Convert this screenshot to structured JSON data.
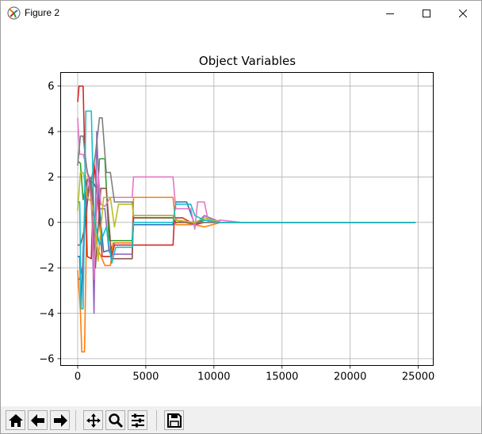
{
  "window": {
    "title": "Figure 2",
    "icons": {
      "app": "matplotlib-icon",
      "minimize": "minimize-icon",
      "maximize": "maximize-icon",
      "close": "close-icon"
    }
  },
  "toolbar": {
    "buttons": [
      {
        "name": "home-icon",
        "tooltip": "Home"
      },
      {
        "name": "back-icon",
        "tooltip": "Back"
      },
      {
        "name": "forward-icon",
        "tooltip": "Forward"
      },
      {
        "name": "pan-icon",
        "tooltip": "Pan"
      },
      {
        "name": "zoom-icon",
        "tooltip": "Zoom"
      },
      {
        "name": "configure-subplots-icon",
        "tooltip": "Subplots"
      },
      {
        "name": "save-icon",
        "tooltip": "Save"
      }
    ]
  },
  "chart_data": {
    "type": "line",
    "title": "Object Variables",
    "xlabel": "",
    "ylabel": "",
    "xlim": [
      -1250,
      26100
    ],
    "ylim": [
      -6.3,
      6.6
    ],
    "xticks": [
      0,
      5000,
      10000,
      15000,
      20000,
      25000
    ],
    "xtick_labels": [
      "0",
      "5000",
      "10000",
      "15000",
      "20000",
      "25000"
    ],
    "yticks": [
      -6,
      -4,
      -2,
      0,
      2,
      4,
      6
    ],
    "ytick_labels": [
      "−6",
      "−4",
      "−2",
      "0",
      "2",
      "4",
      "6"
    ],
    "grid": true,
    "legend": "none",
    "series": [
      {
        "color": "#1f77b4",
        "points": [
          [
            0,
            -1.5
          ],
          [
            150,
            -1.5
          ],
          [
            250,
            -3.8
          ],
          [
            500,
            0.3
          ],
          [
            900,
            1.9
          ],
          [
            1200,
            1.7
          ],
          [
            1500,
            1.3
          ],
          [
            1900,
            -1.3
          ],
          [
            2400,
            -1.2
          ],
          [
            2700,
            -0.9
          ],
          [
            4000,
            -0.9
          ],
          [
            4100,
            -0.1
          ],
          [
            7000,
            -0.1
          ],
          [
            7200,
            0.9
          ],
          [
            8000,
            0.9
          ],
          [
            8600,
            -0.1
          ],
          [
            9300,
            0.2
          ],
          [
            10500,
            0.0
          ],
          [
            12000,
            0.0
          ],
          [
            24800,
            0.0
          ]
        ]
      },
      {
        "color": "#ff7f0e",
        "points": [
          [
            0,
            -2.1
          ],
          [
            200,
            -3.9
          ],
          [
            300,
            -5.7
          ],
          [
            500,
            -5.7
          ],
          [
            700,
            1.5
          ],
          [
            900,
            1.4
          ],
          [
            1200,
            -0.5
          ],
          [
            1500,
            -1.2
          ],
          [
            2000,
            -1.9
          ],
          [
            2400,
            -1.9
          ],
          [
            2600,
            -0.9
          ],
          [
            4000,
            -0.9
          ],
          [
            4100,
            1.1
          ],
          [
            7000,
            1.1
          ],
          [
            7200,
            -0.1
          ],
          [
            8600,
            -0.1
          ],
          [
            9300,
            -0.2
          ],
          [
            10500,
            0.0
          ],
          [
            12000,
            0.0
          ],
          [
            24800,
            0.0
          ]
        ]
      },
      {
        "color": "#2ca02c",
        "points": [
          [
            0,
            2.7
          ],
          [
            200,
            2.6
          ],
          [
            400,
            1.0
          ],
          [
            700,
            1.9
          ],
          [
            1000,
            1.9
          ],
          [
            1300,
            -0.5
          ],
          [
            1600,
            2.8
          ],
          [
            2000,
            2.8
          ],
          [
            2300,
            -0.8
          ],
          [
            4000,
            -0.8
          ],
          [
            4100,
            0.2
          ],
          [
            7000,
            0.2
          ],
          [
            7300,
            0.1
          ],
          [
            8600,
            -0.1
          ],
          [
            9300,
            0.1
          ],
          [
            10500,
            0.0
          ],
          [
            12000,
            0.0
          ],
          [
            24800,
            0.0
          ]
        ]
      },
      {
        "color": "#d62728",
        "points": [
          [
            0,
            5.3
          ],
          [
            100,
            6.0
          ],
          [
            400,
            6.0
          ],
          [
            700,
            -1.5
          ],
          [
            1000,
            -1.6
          ],
          [
            1200,
            2.6
          ],
          [
            1500,
            0.9
          ],
          [
            1800,
            -1.5
          ],
          [
            2300,
            -1.5
          ],
          [
            2500,
            -1.5
          ],
          [
            2700,
            -1.0
          ],
          [
            3500,
            -1.0
          ],
          [
            4000,
            -1.0
          ],
          [
            4100,
            -1.0
          ],
          [
            7000,
            -1.0
          ],
          [
            7100,
            0.2
          ],
          [
            7700,
            0.2
          ],
          [
            8600,
            -0.1
          ],
          [
            9300,
            0.0
          ],
          [
            10500,
            0.0
          ],
          [
            12000,
            0.0
          ],
          [
            24800,
            0.0
          ]
        ]
      },
      {
        "color": "#9467bd",
        "points": [
          [
            0,
            -2.5
          ],
          [
            150,
            -2.5
          ],
          [
            400,
            -1.8
          ],
          [
            700,
            1.8
          ],
          [
            1000,
            2.0
          ],
          [
            1200,
            -4.0
          ],
          [
            1400,
            4.0
          ],
          [
            1600,
            0.6
          ],
          [
            2000,
            0.6
          ],
          [
            2300,
            -1.3
          ],
          [
            2600,
            -1.4
          ],
          [
            4000,
            -1.4
          ],
          [
            4100,
            0.3
          ],
          [
            7000,
            0.3
          ],
          [
            7200,
            0.1
          ],
          [
            8600,
            -0.1
          ],
          [
            9300,
            0.3
          ],
          [
            10500,
            0.0
          ],
          [
            12000,
            0.0
          ],
          [
            24800,
            0.0
          ]
        ]
      },
      {
        "color": "#8c564b",
        "points": [
          [
            0,
            -1.0
          ],
          [
            200,
            -1.0
          ],
          [
            500,
            -0.3
          ],
          [
            900,
            1.9
          ],
          [
            1300,
            -2.0
          ],
          [
            1700,
            1.5
          ],
          [
            2100,
            1.5
          ],
          [
            2500,
            -1.6
          ],
          [
            4000,
            -1.6
          ],
          [
            4100,
            0.2
          ],
          [
            7000,
            0.2
          ],
          [
            7200,
            0.0
          ],
          [
            8600,
            0.0
          ],
          [
            9300,
            0.0
          ],
          [
            12000,
            0.0
          ],
          [
            24800,
            0.0
          ]
        ]
      },
      {
        "color": "#e377c2",
        "points": [
          [
            0,
            4.6
          ],
          [
            150,
            3.0
          ],
          [
            400,
            3.0
          ],
          [
            700,
            2.3
          ],
          [
            1000,
            1.0
          ],
          [
            1200,
            -2.5
          ],
          [
            1500,
            2.2
          ],
          [
            1700,
            0.8
          ],
          [
            2000,
            0.7
          ],
          [
            2400,
            1.1
          ],
          [
            3000,
            1.1
          ],
          [
            4000,
            1.1
          ],
          [
            4100,
            2.0
          ],
          [
            7000,
            2.0
          ],
          [
            7200,
            0.6
          ],
          [
            8300,
            0.6
          ],
          [
            8600,
            -0.3
          ],
          [
            8800,
            0.9
          ],
          [
            9300,
            0.9
          ],
          [
            9600,
            0.0
          ],
          [
            10500,
            0.1
          ],
          [
            12000,
            0.0
          ],
          [
            24800,
            0.0
          ]
        ]
      },
      {
        "color": "#7f7f7f",
        "points": [
          [
            0,
            2.5
          ],
          [
            200,
            3.8
          ],
          [
            400,
            3.8
          ],
          [
            700,
            2.2
          ],
          [
            1000,
            1.8
          ],
          [
            1300,
            3.0
          ],
          [
            1600,
            4.6
          ],
          [
            1800,
            4.6
          ],
          [
            2100,
            2.2
          ],
          [
            2400,
            2.2
          ],
          [
            2700,
            0.9
          ],
          [
            4000,
            0.9
          ],
          [
            4100,
            0.3
          ],
          [
            7000,
            0.3
          ],
          [
            7100,
            0.1
          ],
          [
            8600,
            0.0
          ],
          [
            9300,
            0.0
          ],
          [
            12000,
            0.0
          ],
          [
            24800,
            0.0
          ]
        ]
      },
      {
        "color": "#bcbd22",
        "points": [
          [
            0,
            0.5
          ],
          [
            200,
            2.2
          ],
          [
            400,
            2.2
          ],
          [
            700,
            1.1
          ],
          [
            1000,
            0.9
          ],
          [
            1300,
            0.1
          ],
          [
            1500,
            -1.7
          ],
          [
            1900,
            1.1
          ],
          [
            2400,
            1.1
          ],
          [
            2700,
            -0.2
          ],
          [
            3000,
            0.8
          ],
          [
            4000,
            0.8
          ],
          [
            4100,
            0.3
          ],
          [
            7000,
            0.3
          ],
          [
            7200,
            0.1
          ],
          [
            8600,
            0.0
          ],
          [
            9300,
            0.2
          ],
          [
            10500,
            0.0
          ],
          [
            12000,
            0.0
          ],
          [
            24800,
            0.0
          ]
        ]
      },
      {
        "color": "#17becf",
        "points": [
          [
            0,
            0.9
          ],
          [
            150,
            0.9
          ],
          [
            250,
            -3.8
          ],
          [
            400,
            -3.8
          ],
          [
            600,
            4.9
          ],
          [
            1000,
            4.9
          ],
          [
            1200,
            0.3
          ],
          [
            1600,
            -1.0
          ],
          [
            2100,
            -0.2
          ],
          [
            2500,
            -1.8
          ],
          [
            2800,
            -1.1
          ],
          [
            3300,
            -1.1
          ],
          [
            4000,
            -1.1
          ],
          [
            4100,
            0.0
          ],
          [
            7000,
            0.0
          ],
          [
            7200,
            0.8
          ],
          [
            8300,
            0.8
          ],
          [
            8600,
            0.3
          ],
          [
            9300,
            0.1
          ],
          [
            10500,
            0.0
          ],
          [
            12000,
            0.0
          ],
          [
            24800,
            0.0
          ]
        ]
      }
    ]
  }
}
